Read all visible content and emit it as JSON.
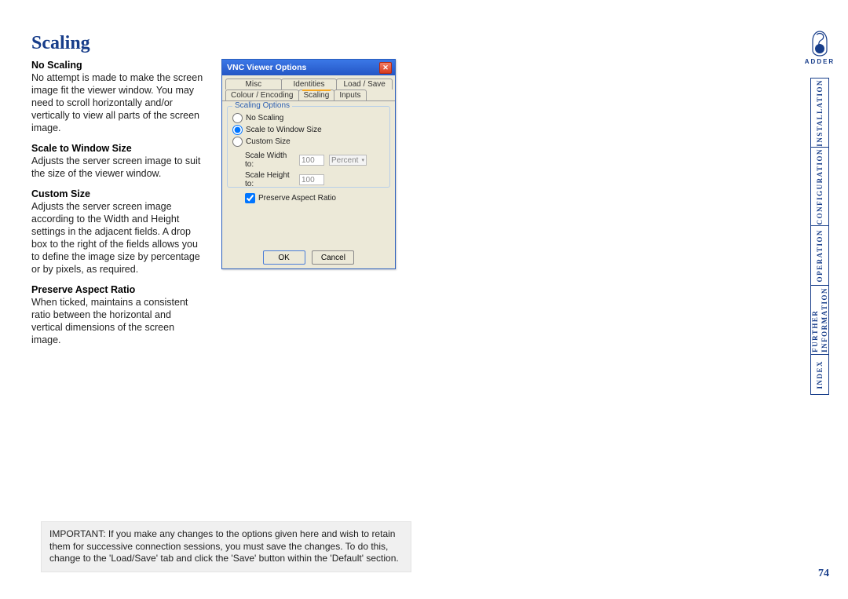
{
  "page": {
    "title": "Scaling",
    "number": "74"
  },
  "sections": {
    "noScaling": {
      "heading": "No Scaling",
      "body": "No attempt is made to make the screen image fit the viewer window. You may need to scroll horizontally and/or vertically to view all parts of the screen image."
    },
    "scaleToWindow": {
      "heading": "Scale to Window Size",
      "body": "Adjusts the server screen image to suit the size of the viewer window."
    },
    "customSize": {
      "heading": "Custom Size",
      "body": "Adjusts the server screen image according to the Width and Height settings in the adjacent fields. A drop box to the right of the fields allows you to define the image size by percentage or by pixels, as required."
    },
    "preserveAspect": {
      "heading": "Preserve Aspect Ratio",
      "body": "When ticked, maintains a consistent ratio between the horizontal and vertical dimensions of the screen image."
    }
  },
  "dialog": {
    "title": "VNC Viewer Options",
    "tabsRow1": {
      "misc": "Misc",
      "identities": "Identities",
      "loadSave": "Load / Save"
    },
    "tabsRow2": {
      "colourEncoding": "Colour / Encoding",
      "scaling": "Scaling",
      "inputs": "Inputs"
    },
    "group": {
      "legend": "Scaling Options",
      "radioNoScaling": "No Scaling",
      "radioScaleToWindow": "Scale to Window Size",
      "radioCustomSize": "Custom Size",
      "widthLabel": "Scale Width to:",
      "widthValue": "100",
      "heightLabel": "Scale Height to:",
      "heightValue": "100",
      "unit": "Percent",
      "aspectLabel": "Preserve Aspect Ratio"
    },
    "buttons": {
      "ok": "OK",
      "cancel": "Cancel"
    }
  },
  "important": "IMPORTANT: If you make any changes to the options given here and wish to retain them for successive connection sessions, you must save the changes. To do this, change to the 'Load/Save' tab and click the 'Save' button within the 'Default' section.",
  "sidebar": {
    "brand": "ADDER",
    "installation": "INSTALLATION",
    "configuration": "CONFIGURATION",
    "operation": "OPERATION",
    "furtherLine1": "FURTHER",
    "furtherLine2": "INFORMATION",
    "index": "INDEX"
  }
}
